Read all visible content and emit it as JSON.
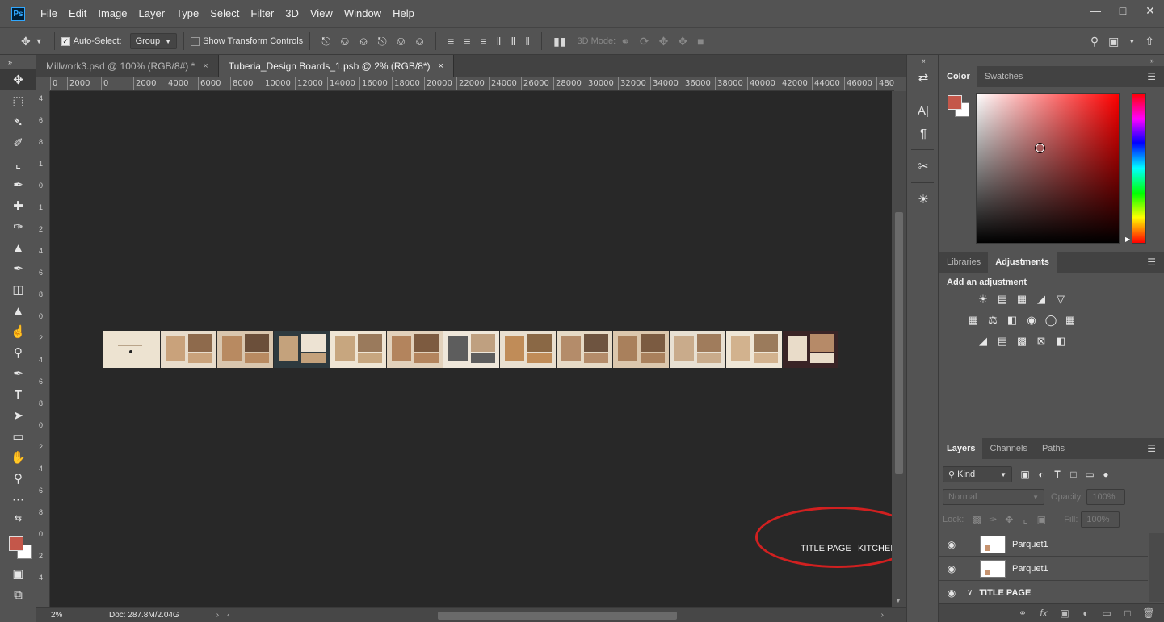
{
  "app": {
    "logo": "Ps",
    "menu": [
      "File",
      "Edit",
      "Image",
      "Layer",
      "Type",
      "Select",
      "Filter",
      "3D",
      "View",
      "Window",
      "Help"
    ],
    "window_controls": [
      "minimize-icon",
      "restore-icon",
      "close-icon"
    ]
  },
  "options": {
    "auto_select_label": "Auto-Select:",
    "auto_select_checked": true,
    "auto_select_target": "Group",
    "transform_controls_label": "Show Transform Controls",
    "transform_controls_checked": false,
    "mode_3d_label": "3D Mode:"
  },
  "tools": [
    "move-tool",
    "marquee-tool",
    "lasso-tool",
    "quick-select-tool",
    "crop-tool",
    "eyedropper-tool",
    "healing-brush-tool",
    "brush-tool",
    "clone-stamp-tool",
    "history-brush-tool",
    "eraser-tool",
    "paint-bucket-tool",
    "smudge-tool",
    "dodge-tool",
    "pen-tool",
    "type-tool",
    "path-select-tool",
    "rectangle-tool",
    "hand-tool",
    "zoom-tool",
    "more-tools"
  ],
  "document_tabs": [
    {
      "label": "Millwork3.psd @ 100% (RGB/8#) *",
      "close": "×",
      "active": false
    },
    {
      "label": "Tuberia_Design Boards_1.psb @ 2% (RGB/8*)",
      "close": "×",
      "active": true
    }
  ],
  "rulers": {
    "top_labels": [
      "0",
      "2000",
      "0",
      "2000",
      "4000",
      "6000",
      "8000",
      "10000",
      "12000",
      "14000",
      "16000",
      "18000",
      "20000",
      "22000",
      "24000",
      "26000",
      "28000",
      "30000",
      "32000",
      "34000",
      "36000",
      "38000",
      "40000",
      "42000",
      "44000",
      "46000",
      "480"
    ],
    "left_labels": [
      "4",
      "6",
      "8",
      "1",
      "0",
      "1",
      "2",
      "4",
      "6",
      "8",
      "0",
      "2",
      "4",
      "6",
      "8",
      "0",
      "2",
      "4",
      "6",
      "8",
      "0",
      "2",
      "4"
    ]
  },
  "canvas": {
    "artboard_labels": [
      "TITLE PAGE",
      "KITCHEN"
    ],
    "artboard_count": 13
  },
  "status": {
    "zoom": "2%",
    "doc_size": "Doc: 287.8M/2.04G"
  },
  "color_panel": {
    "tabs": [
      "Color",
      "Swatches"
    ],
    "foreground": "#c4574a",
    "background": "#ffffff"
  },
  "adjustments_panel": {
    "tabs": [
      "Libraries",
      "Adjustments"
    ],
    "title": "Add an adjustment",
    "rows": [
      [
        "brightness-contrast-icon",
        "levels-icon",
        "curves-icon",
        "exposure-icon",
        "vibrance-icon"
      ],
      [
        "hue-saturation-icon",
        "color-balance-icon",
        "black-white-icon",
        "photo-filter-icon",
        "channel-mixer-icon",
        "color-lookup-icon"
      ],
      [
        "invert-icon",
        "posterize-icon",
        "threshold-icon",
        "selective-color-icon",
        "gradient-map-icon"
      ]
    ]
  },
  "layers_panel": {
    "tabs": [
      "Layers",
      "Channels",
      "Paths"
    ],
    "filter": "Kind",
    "blend_mode": "Normal",
    "opacity_label": "Opacity:",
    "opacity_value": "100%",
    "lock_label": "Lock:",
    "fill_label": "Fill:",
    "fill_value": "100%",
    "layers": [
      {
        "name": "Parquet1",
        "visible": true,
        "type": "layer"
      },
      {
        "name": "Parquet1",
        "visible": true,
        "type": "layer"
      },
      {
        "name": "TITLE PAGE",
        "visible": true,
        "type": "group"
      }
    ]
  }
}
